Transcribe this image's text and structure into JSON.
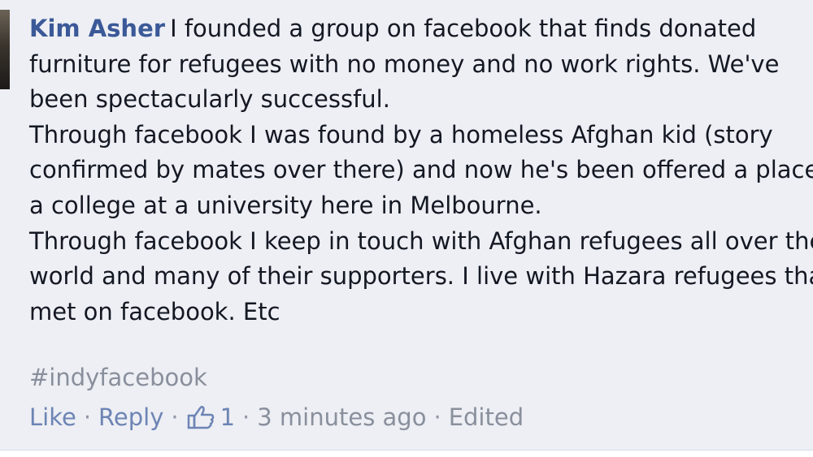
{
  "comment": {
    "author": "Kim Asher",
    "lines": [
      "I founded a group on facebook that finds donated",
      "furniture for refugees with no money and no work rights. We've",
      "been spectacularly successful.",
      "Through facebook I was found by a homeless Afghan kid (story",
      "confirmed by mates over there) and now he's been offered a place",
      "a college at a university here in Melbourne.",
      "Through facebook I keep in touch with Afghan refugees all over the",
      "world and many of their supporters. I live with Hazara refugees that",
      "met on facebook. Etc"
    ],
    "hashtag": "#indyfacebook"
  },
  "actions": {
    "like": "Like",
    "reply": "Reply",
    "like_count": "1",
    "timestamp": "3 minutes ago",
    "edited": "Edited",
    "separator": "·"
  },
  "colors": {
    "background": "#edeff4",
    "author": "#3b5998",
    "link": "#6d84b4",
    "meta": "#898f9c"
  },
  "icons": {
    "like": "thumbs-up-icon"
  }
}
